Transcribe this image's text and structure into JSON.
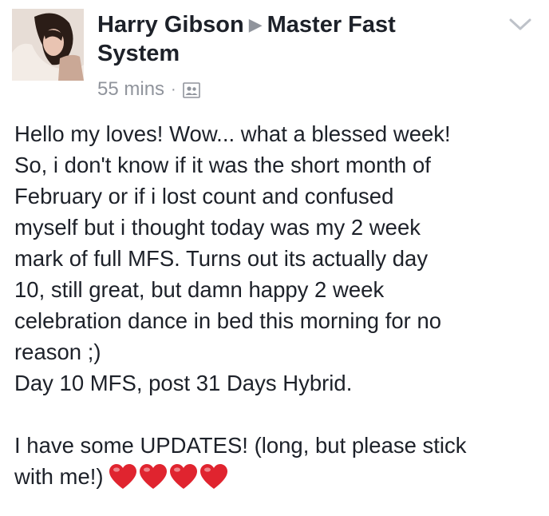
{
  "post": {
    "author": "Harry Gibson",
    "group": "Master Fast System",
    "time": "55 mins",
    "separator": "·",
    "audience_icon": "group-audience-icon",
    "menu_icon": "chevron-down-icon",
    "paragraphs": [
      "Hello my loves! Wow... what a blessed week!\nSo, i don't know if it was the short month of\nFebruary or if i lost count and confused\nmyself but i thought today was my 2 week\nmark of full MFS. Turns out its actually day\n10, still great, but damn happy 2 week\ncelebration dance in bed this morning for no\nreason ;)\nDay 10 MFS, post 31 Days Hybrid."
    ],
    "updates_line1": "I have some UPDATES! (long, but please stick",
    "updates_line2": "with me!)",
    "hearts_count": 4,
    "heart_color": "#e0242f"
  }
}
